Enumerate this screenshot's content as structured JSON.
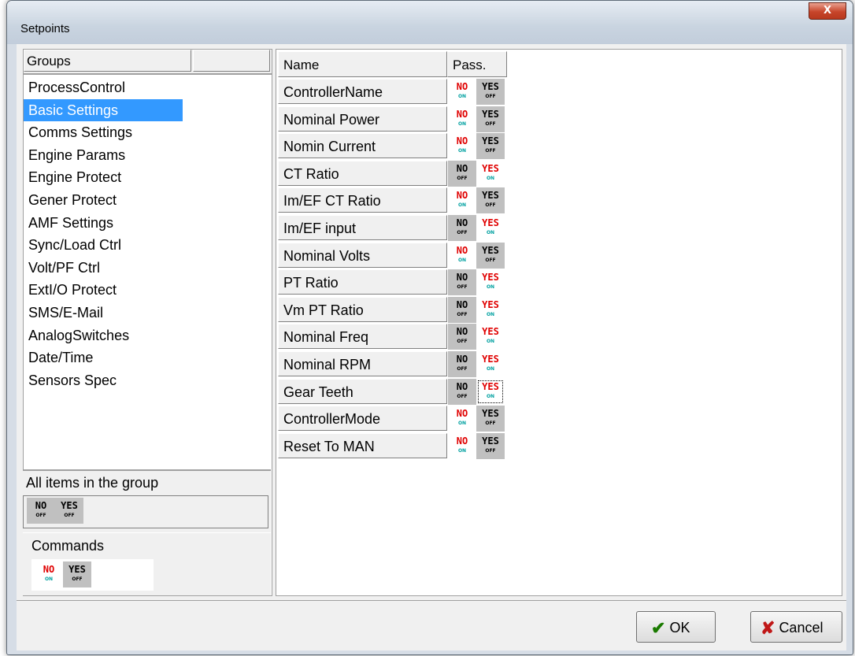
{
  "window": {
    "title": "Setpoints",
    "close_glyph": "X"
  },
  "groups_panel": {
    "header": "Groups",
    "items": [
      {
        "label": "ProcessControl",
        "selected": false
      },
      {
        "label": "Basic Settings",
        "selected": true
      },
      {
        "label": "Comms Settings",
        "selected": false
      },
      {
        "label": "Engine Params",
        "selected": false
      },
      {
        "label": "Engine Protect",
        "selected": false
      },
      {
        "label": "Gener Protect",
        "selected": false
      },
      {
        "label": "AMF Settings",
        "selected": false
      },
      {
        "label": "Sync/Load Ctrl",
        "selected": false
      },
      {
        "label": "Volt/PF Ctrl",
        "selected": false
      },
      {
        "label": "ExtI/O Protect",
        "selected": false
      },
      {
        "label": "SMS/E-Mail",
        "selected": false
      },
      {
        "label": "AnalogSwitches",
        "selected": false
      },
      {
        "label": "Date/Time",
        "selected": false
      },
      {
        "label": "Sensors Spec",
        "selected": false
      }
    ]
  },
  "all_items": {
    "label": "All items in the group",
    "no": "NO",
    "no_sub": "OFF",
    "yes": "YES",
    "yes_sub": "OFF"
  },
  "commands": {
    "label": "Commands",
    "no": "NO",
    "no_sub": "ON",
    "yes": "YES",
    "yes_sub": "OFF"
  },
  "table": {
    "columns": [
      "Name",
      "Pass."
    ],
    "rows": [
      {
        "name": "ControllerName",
        "state": "NO"
      },
      {
        "name": "Nominal Power",
        "state": "NO"
      },
      {
        "name": "Nomin Current",
        "state": "NO"
      },
      {
        "name": "CT Ratio",
        "state": "YES"
      },
      {
        "name": "Im/EF CT Ratio",
        "state": "NO"
      },
      {
        "name": "Im/EF input",
        "state": "YES"
      },
      {
        "name": "Nominal Volts",
        "state": "NO"
      },
      {
        "name": "PT Ratio",
        "state": "YES"
      },
      {
        "name": "Vm PT Ratio",
        "state": "YES"
      },
      {
        "name": "Nominal Freq",
        "state": "YES"
      },
      {
        "name": "Nominal RPM",
        "state": "YES"
      },
      {
        "name": "Gear Teeth",
        "state": "YES",
        "focused": true
      },
      {
        "name": "ControllerMode",
        "state": "NO"
      },
      {
        "name": "Reset To MAN",
        "state": "NO"
      }
    ],
    "switch_text": {
      "no": "NO",
      "yes": "YES",
      "on": "ON",
      "off": "OFF"
    }
  },
  "buttons": {
    "ok": "OK",
    "cancel": "Cancel"
  },
  "colors": {
    "selection": "#3399ff",
    "switch_on_text": "#e00000",
    "switch_on_sub": "#00a0a0",
    "switch_off_bg": "#c0c0c0",
    "ok_icon": "#1a7a00",
    "cancel_icon": "#c01818"
  },
  "icons": {
    "ok": "check-icon",
    "cancel": "x-mark-icon"
  }
}
